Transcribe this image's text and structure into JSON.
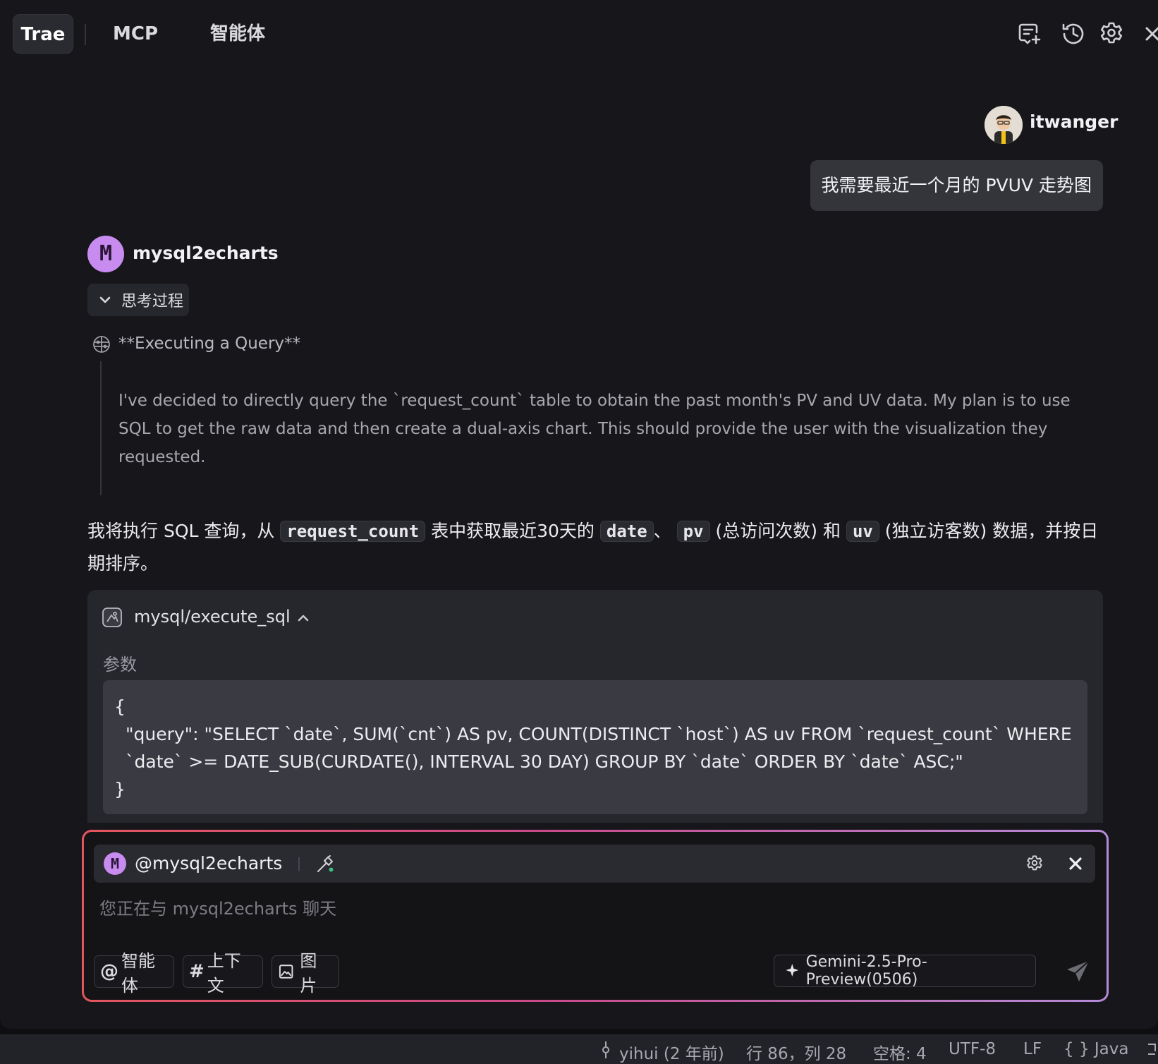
{
  "tabs": {
    "trae": "Trae",
    "mcp": "MCP",
    "agent": "智能体"
  },
  "user": {
    "name": "itwanger",
    "message": "我需要最近一个月的 PVUV 走势图"
  },
  "agent": {
    "avatar_letter": "M",
    "name": "mysql2echarts",
    "thinking_label": "思考过程",
    "thinking_title": "**Executing a Query**",
    "thinking_body": "I've decided to directly query the `request_count` table to obtain the past month's PV and UV data. My plan is to use SQL to get the raw data and then create a dual-axis chart. This should provide the user with the visualization they requested.",
    "answer": {
      "p1": "我将执行 SQL 查询，从",
      "c1": "request_count",
      "p2": "表中获取最近30天的",
      "c2": "date",
      "p3": "、",
      "c3": "pv",
      "p4": "(总访问次数) 和",
      "c4": "uv",
      "p5": "(独立访客数) 数据，并按日期排序。"
    }
  },
  "tool": {
    "name": "mysql/execute_sql",
    "params_label": "参数",
    "open_brace": "{",
    "query_line": "\"query\": \"SELECT `date`, SUM(`cnt`) AS pv, COUNT(DISTINCT `host`) AS uv FROM `request_count` WHERE `date` >= DATE_SUB(CURDATE(), INTERVAL 30 DAY) GROUP BY `date` ORDER BY `date` ASC;\"",
    "close_brace": "}"
  },
  "input": {
    "mention": "@mysql2echarts",
    "placeholder": "您正在与 mysql2echarts 聊天",
    "chips": {
      "agent": "智能体",
      "context": "上下文",
      "image": "图片"
    },
    "chip_symbols": {
      "agent": "@",
      "context": "#"
    },
    "model": "Gemini-2.5-Pro-Preview(0506)"
  },
  "status": {
    "git": "yihui (2 年前)",
    "position": "行 86，列 28",
    "indent": "空格: 4",
    "encoding": "UTF-8",
    "eol": "LF",
    "language": "{ } Java"
  },
  "colors": {
    "accent_agent": "#c88bf0",
    "border_gradient_start": "#e2555e",
    "border_gradient_end": "#b58ad8"
  }
}
